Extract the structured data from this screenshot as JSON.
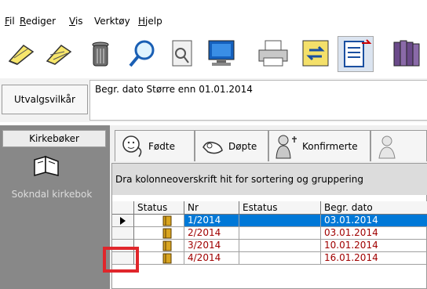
{
  "menu": {
    "items": [
      {
        "key": "F",
        "rest": "il"
      },
      {
        "key": "R",
        "rest": "ediger"
      },
      {
        "key": "V",
        "rest": "is"
      },
      {
        "key": "",
        "rest": "Verktøy"
      },
      {
        "key": "H",
        "rest": "jelp"
      }
    ]
  },
  "toolbar": {
    "icons": [
      "edit-icon",
      "edit-alt-icon",
      "trash-icon",
      "search-icon",
      "preview-icon",
      "monitor-icon",
      "printer-icon",
      "refresh-icon",
      "columns-icon",
      "books-icon"
    ]
  },
  "criteria": {
    "button_label": "Utvalgsvilkår",
    "text": "Begr. dato Større enn 01.01.2014"
  },
  "sidebar": {
    "header": "Kirkebøker",
    "book_label": "Sokndal kirkebok"
  },
  "tabs": [
    {
      "label": "Fødte",
      "icon": "baby-icon"
    },
    {
      "label": "Døpte",
      "icon": "baptism-icon"
    },
    {
      "label": "Konfirmerte",
      "icon": "confirmation-icon"
    }
  ],
  "grid": {
    "group_hint": "Dra kolonneoverskrift hit for sortering og gruppering",
    "columns": [
      "Status",
      "Nr",
      "Estatus",
      "Begr. dato"
    ],
    "rows": [
      {
        "nr": "1/2014",
        "estatus": "",
        "date": "03.01.2014",
        "selected": true
      },
      {
        "nr": "2/2014",
        "estatus": "",
        "date": "03.01.2014",
        "selected": false
      },
      {
        "nr": "3/2014",
        "estatus": "",
        "date": "10.01.2014",
        "selected": false
      },
      {
        "nr": "4/2014",
        "estatus": "",
        "date": "16.01.2014",
        "selected": false
      }
    ]
  },
  "colors": {
    "selection": "#0078d7",
    "date_text": "#a00000",
    "highlight_box": "#e0262b"
  }
}
